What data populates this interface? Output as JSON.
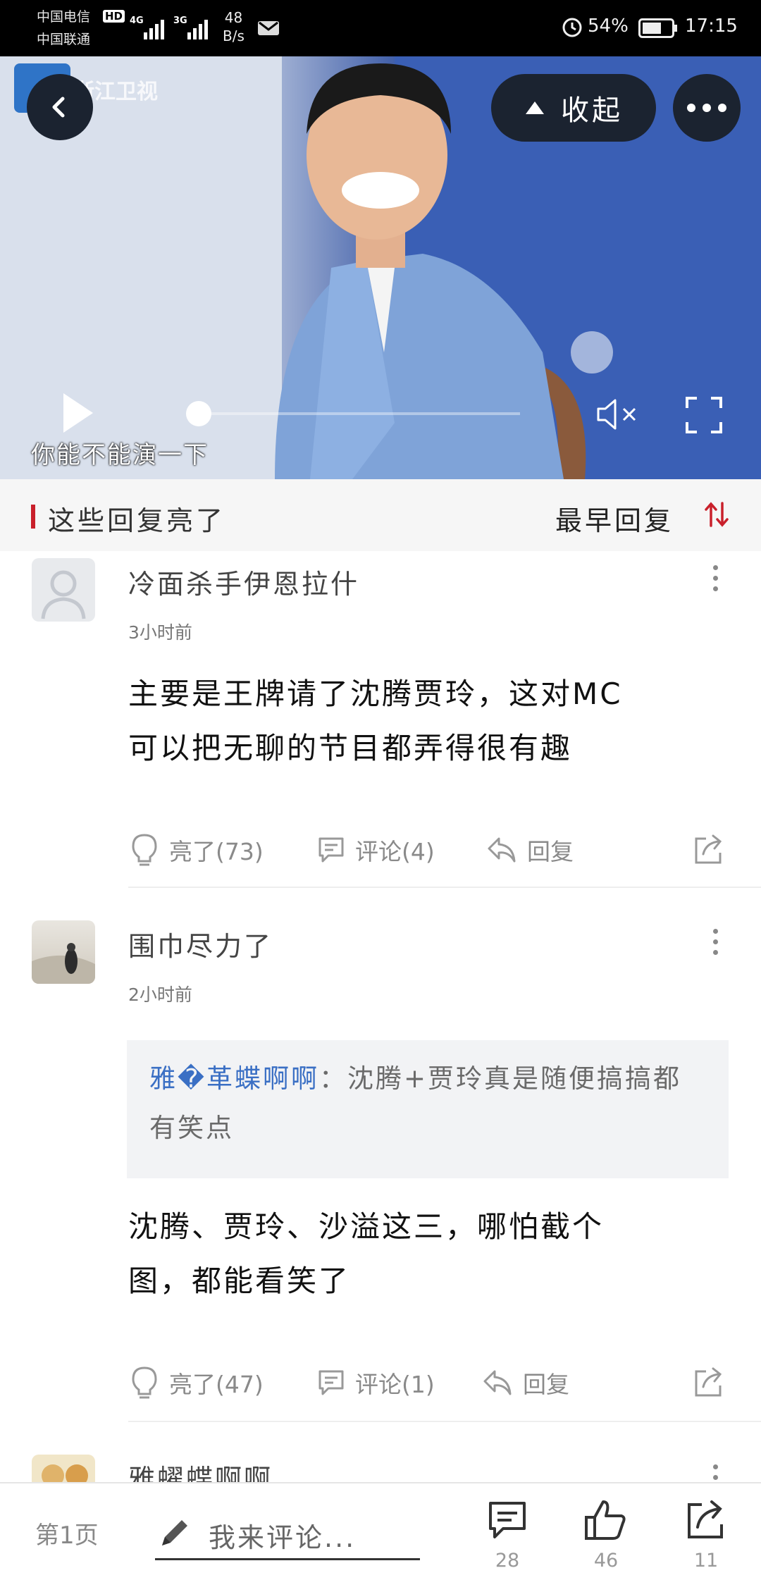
{
  "status_bar": {
    "carrier1": "中国电信",
    "hd": "HD",
    "carrier2": "中国联通",
    "net1": "4G",
    "net2": "3G",
    "speed_value": "48",
    "speed_unit": "B/s",
    "battery": "54%",
    "time": "17:15"
  },
  "video": {
    "channel_logo": "浙江卫视",
    "collapse_label": "收起",
    "subtitle": "你能不能演一下",
    "progress": 0.0
  },
  "section": {
    "title": "这些回复亮了",
    "sort_label": "最早回复",
    "accent": "#c9202b"
  },
  "comments": [
    {
      "user": "冷面杀手伊恩拉什",
      "time": "3小时前",
      "text_line1": "主要是王牌请了沈腾贾玲，这对MC",
      "text_line2": "可以把无聊的节目都弄得很有趣",
      "like_label": "亮了(73)",
      "comment_label": "评论(4)",
      "reply_label": "回复"
    },
    {
      "user": "围巾尽力了",
      "time": "2小时前",
      "quote_user": "雅�革蝶啊啊",
      "quote_text": "：沈腾+贾玲真是随便搞搞都有笑点",
      "text_line1": "沈腾、贾玲、沙溢这三，哪怕截个",
      "text_line2": "图，都能看笑了",
      "like_label": "亮了(47)",
      "comment_label": "评论(1)",
      "reply_label": "回复"
    },
    {
      "user": "雅蠗蝶啊啊"
    }
  ],
  "bottom_bar": {
    "page_label": "第1页",
    "comment_placeholder": "我来评论...",
    "comment_count": "28",
    "like_count": "46",
    "share_count": "11"
  },
  "icons": {
    "back": "chevron-left-icon",
    "collapse": "triangle-up-icon",
    "more": "more-horizontal-icon",
    "play": "play-icon",
    "mute": "volume-mute-icon",
    "fullscreen": "fullscreen-icon",
    "sort": "sort-arrows-icon",
    "like": "lightbulb-icon",
    "comment": "comment-icon",
    "reply": "reply-icon",
    "share": "share-icon",
    "pencil": "pencil-icon",
    "thumbs_up": "thumbs-up-icon"
  }
}
